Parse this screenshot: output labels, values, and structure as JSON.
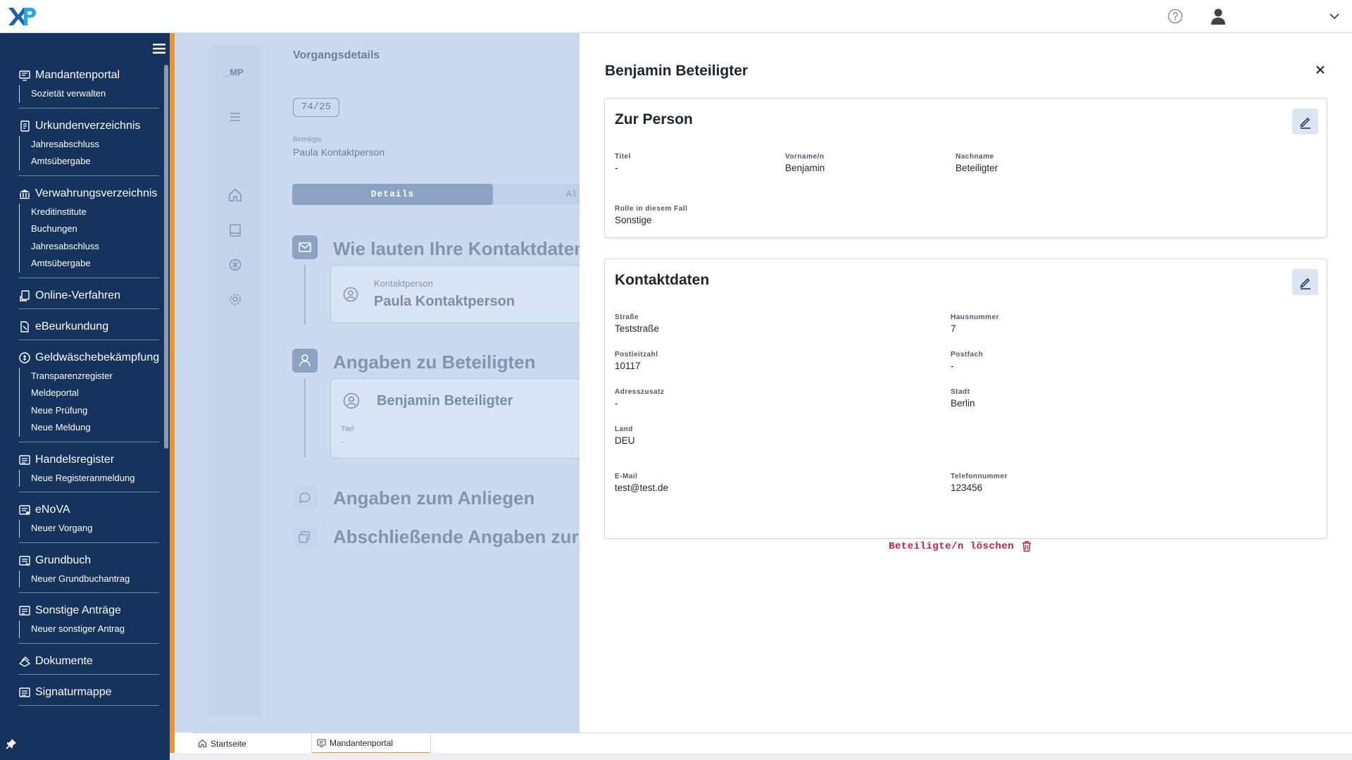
{
  "header": {
    "logo_text": "XP"
  },
  "sidebar": {
    "sections": [
      {
        "label": "Mandantenportal",
        "icon": "portal-icon",
        "items": [
          "Sozietät verwalten"
        ]
      },
      {
        "label": "Urkundenverzeichnis",
        "icon": "document-list-icon",
        "items": [
          "Jahresabschluss",
          "Amtsübergabe"
        ]
      },
      {
        "label": "Verwahrungsverzeichnis",
        "icon": "bank-icon",
        "items": [
          "Kreditinstitute",
          "Buchungen",
          "Jahresabschluss",
          "Amtsübergabe"
        ]
      },
      {
        "label": "Online-Verfahren",
        "icon": "online-procedure-icon",
        "items": []
      },
      {
        "label": "eBeurkundung",
        "icon": "e-notarization-icon",
        "items": []
      },
      {
        "label": "Geldwäschebekämpfung",
        "icon": "anti-money-laundering-icon",
        "items": [
          "Transparenzregister",
          "Meldeportal",
          "Neue Prüfung",
          "Neue Meldung"
        ]
      },
      {
        "label": "Handelsregister",
        "icon": "register-icon",
        "items": [
          "Neue Registeranmeldung"
        ]
      },
      {
        "label": "eNoVA",
        "icon": "enova-icon",
        "items": [
          "Neuer Vorgang"
        ]
      },
      {
        "label": "Grundbuch",
        "icon": "land-register-icon",
        "items": [
          "Neuer Grundbuchantrag"
        ]
      },
      {
        "label": "Sonstige Anträge",
        "icon": "other-requests-icon",
        "items": [
          "Neuer sonstiger Antrag"
        ]
      },
      {
        "label": "Dokumente",
        "icon": "documents-icon",
        "items": []
      },
      {
        "label": "Signaturmappe",
        "icon": "signature-folder-icon",
        "items": []
      }
    ]
  },
  "rail": {
    "label": "_MP"
  },
  "vorgang": {
    "title": "Vorgangsdetails",
    "badge": "74/25",
    "beteiligte_label": "Beteiligte",
    "beteiligte_value": "Paula Kontaktperson",
    "tab_details": "Details",
    "tab_other": "Al",
    "steps": [
      {
        "title": "Wie lauten Ihre Kontaktdaten",
        "card_label": "Kontaktperson",
        "card_value": "Paula Kontaktperson"
      },
      {
        "title": "Angaben zu Beteiligten",
        "card_value": "Benjamin Beteiligter",
        "card_field_label": "Titel",
        "card_field_value": "-"
      },
      {
        "title": "Angaben zum Anliegen"
      },
      {
        "title": "Abschließende Angaben zur"
      }
    ]
  },
  "panel": {
    "title": "Benjamin Beteiligter",
    "person": {
      "title": "Zur Person",
      "fields": [
        {
          "label": "Titel",
          "value": "-"
        },
        {
          "label": "Vorname/n",
          "value": "Benjamin"
        },
        {
          "label": "Nachname",
          "value": "Beteiligter"
        },
        {
          "label": "Rolle in diesem Fall",
          "value": "Sonstige"
        }
      ]
    },
    "contact": {
      "title": "Kontaktdaten",
      "fields": [
        {
          "label": "Straße",
          "value": "Teststraße"
        },
        {
          "label": "Hausnummer",
          "value": "7"
        },
        {
          "label": "Postleitzahl",
          "value": "10117"
        },
        {
          "label": "Postfach",
          "value": "-"
        },
        {
          "label": "Adresszusatz",
          "value": "-"
        },
        {
          "label": "Stadt",
          "value": "Berlin"
        },
        {
          "label": "Land",
          "value": "DEU"
        },
        {
          "label": "E-Mail",
          "value": "test@test.de"
        },
        {
          "label": "Telefonnummer",
          "value": "123456"
        }
      ]
    },
    "delete_label": "Beteiligte/n löschen"
  },
  "bottom_tabs": [
    {
      "label": "Startseite",
      "icon": "home-icon"
    },
    {
      "label": "Mandantenportal",
      "icon": "portal-icon"
    }
  ],
  "colors": {
    "sidebar": "#15335c",
    "accent": "#f39325",
    "danger": "#c41f45"
  }
}
